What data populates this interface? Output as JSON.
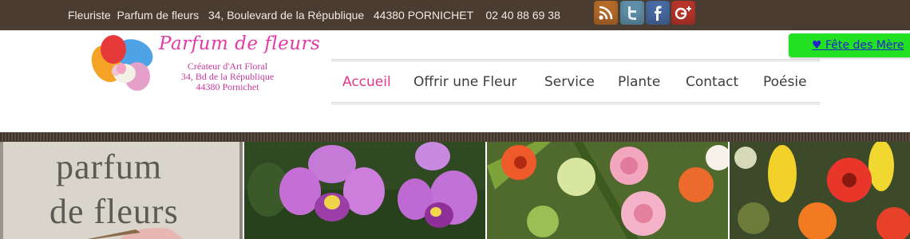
{
  "topbar": {
    "contact_line": "Fleuriste  Parfum de fleurs   34, Boulevard de la République   44380 PORNICHET    02 40 88 69 38",
    "social": [
      {
        "icon": "rss-icon",
        "glyph": ")))"
      },
      {
        "icon": "twitter-icon",
        "glyph": "t"
      },
      {
        "icon": "facebook-icon",
        "glyph": "f"
      },
      {
        "icon": "google-plus-icon",
        "glyph": "g+"
      }
    ]
  },
  "logo": {
    "script": "Parfum de fleurs",
    "line1": "Créateur d'Art Floral",
    "line2": "34, Bd de la République",
    "line3": "44380 Pornichet"
  },
  "nav": {
    "items": [
      {
        "label": "Accueil",
        "active": true
      },
      {
        "label": "Offrir une Fleur"
      },
      {
        "label": "Service"
      },
      {
        "label": "Plante"
      },
      {
        "label": "Contact"
      },
      {
        "label": "Poésie"
      }
    ]
  },
  "promo": {
    "label": "♥ Fête des Mère"
  },
  "gallery": {
    "tile1_line1": "parfum",
    "tile1_line2": "de fleurs"
  },
  "colors": {
    "topbar": "#4a3c30",
    "nav_active": "#e0368c",
    "promo_bg": "#22e022",
    "promo_text": "#2222cc"
  }
}
